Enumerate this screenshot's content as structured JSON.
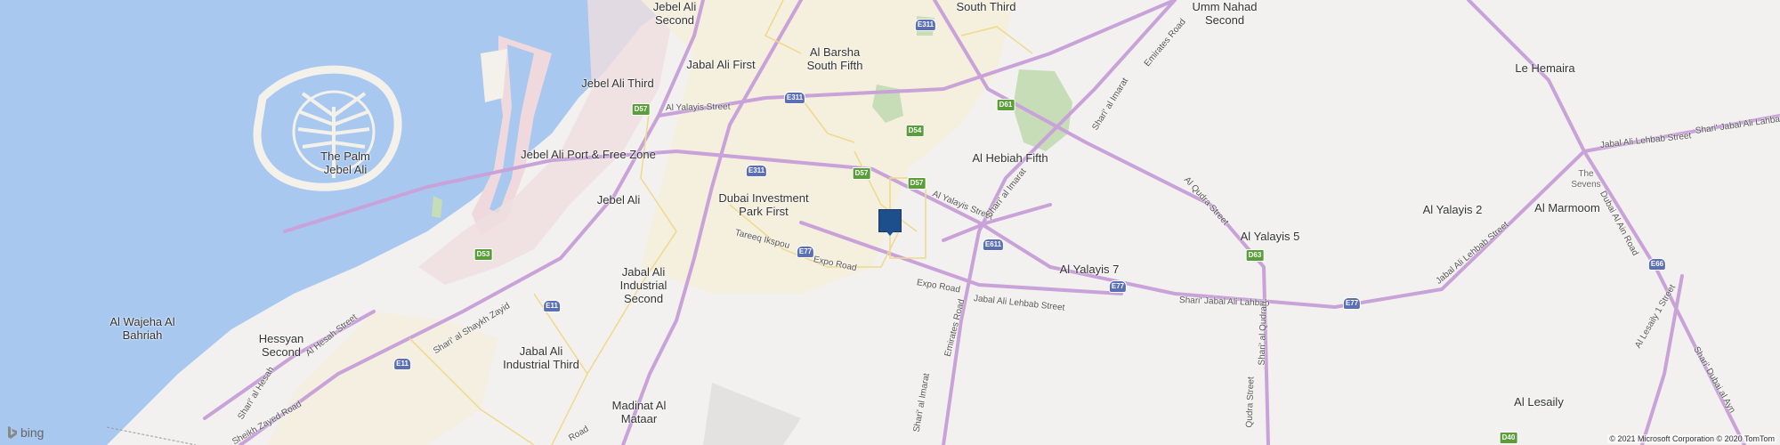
{
  "map": {
    "colors": {
      "water": "#a8c8f0",
      "land": "#f2f1ef",
      "highway": "#c8a2d8",
      "urban": "#ebe4d5",
      "park": "#c6ddb8",
      "marker": "#1f4e8c"
    },
    "places": {
      "jebel_ali_second": "Jebel Ali\nSecond",
      "al_barsha_south_third": "South Third",
      "umm_nahad_second": "Umm Nahad\nSecond",
      "jabal_ali_first": "Jabal Ali First",
      "al_barsha_south_fifth": "Al Barsha\nSouth Fifth",
      "jebel_ali_third": "Jebel Ali Third",
      "le_hemaira": "Le Hemaira",
      "the_palm": "The Palm\nJebel Ali",
      "jebel_ali_port": "Jebel Ali Port & Free Zone",
      "al_hebiah_fifth": "Al Hebiah Fifth",
      "the_sevens": "The\nSevens",
      "jebel_ali": "Jebel Ali",
      "dubai_investment_park": "Dubai Investment\nPark First",
      "al_yalayis_2": "Al Yalayis 2",
      "al_marmoom": "Al Marmoom",
      "al_yalayis_5": "Al Yalayis 5",
      "jabal_ali_industrial_second": "Jabal Ali\nIndustrial\nSecond",
      "al_yalayis_7": "Al Yalayis 7",
      "al_wajeha_al_bahriah": "Al Wajeha Al\nBahriah",
      "hessyan_second": "Hessyan\nSecond",
      "jabal_ali_industrial_third": "Jabal Ali\nIndustrial Third",
      "madinat_al_mataar": "Madinat Al\nMataar",
      "al_lesaily": "Al Lesaily"
    },
    "roads": {
      "al_yalayis_street_w": "Al Yalayis Street",
      "al_yalayis_street_e": "Al Yalayis Street",
      "shari_al_imarat_n": "Shari' al Imarat",
      "emirates_road_n": "Emirates Road",
      "shari_al_imarat_mid": "Shari' al Imarat",
      "al_qudra_street": "Al Qudra Street",
      "jabal_ali_lehbab_street": "Jabal Ali Lehbab Street",
      "shari_jabal_ali_lahbab_ne": "Shari' Jabal Ali Lahbab",
      "al_ain_road": "Dubai Al Ain Road",
      "tareeq_expo": "Tareeq Ikspou",
      "expo_road_1": "Expo Road",
      "expo_road_2": "Expo Road",
      "jabal_ali_lehbab_street_2": "Jabal Ali Lehbab Street",
      "shari_jabal_ali_lahbab": "Shari' Jabal Ali Lahbab",
      "al_qudra_2": "Shari' al Qudrah",
      "qudra_street_s": "Qudra Street",
      "emirates_road_s": "Emirates Road",
      "shari_al_imarat_s": "Shari' al Imarat",
      "al_yalayis_1_street": "Al Lesaily 1 Street",
      "shari_dubai_al_ayn": "Shari' Dubai al Ayn",
      "shari_al_shaykh_zayid": "Shari' al Shaykh Zayid",
      "shari_al_hesah": "Shari' al Hesah",
      "al_hesah_street": "Al Hesah Street",
      "sheikh_zayed_road": "Sheikh Zayed Road",
      "airport_road": "Road"
    },
    "shields": {
      "e311_top": "E311",
      "d57_a": "D57",
      "e311_mid": "E311",
      "d54": "D54",
      "d61": "D61",
      "e311_low": "E311",
      "d57_b": "D57",
      "d57_c": "D57",
      "e611": "E611",
      "e77_a": "E77",
      "d53": "D53",
      "e11": "E11",
      "e11_b": "E11",
      "d63": "D63",
      "e77_b": "E77",
      "e77_c": "E77",
      "e66": "E66",
      "d40": "D40"
    },
    "attribution": "© 2021 Microsoft Corporation © 2020 TomTom",
    "brand": "bing"
  }
}
